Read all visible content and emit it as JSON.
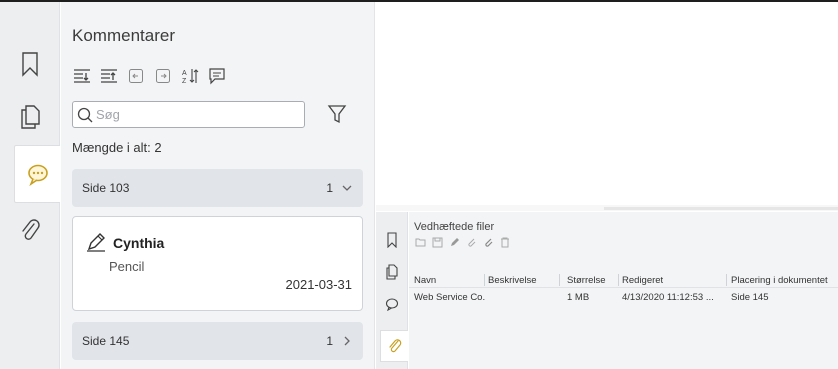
{
  "rail": {
    "tabs": [
      {
        "name": "bookmark-icon",
        "active": false
      },
      {
        "name": "pages-icon",
        "active": false
      },
      {
        "name": "comments-icon",
        "active": true
      },
      {
        "name": "attachment-icon",
        "active": false
      }
    ]
  },
  "comments_panel": {
    "title": "Kommentarer",
    "search_placeholder": "Søg",
    "count_label": "Mængde i alt: 2",
    "groups": [
      {
        "label": "Side 103",
        "count": "1",
        "expanded": true
      },
      {
        "label": "Side 145",
        "count": "1",
        "expanded": false
      }
    ],
    "card": {
      "author": "Cynthia",
      "type": "Pencil",
      "date": "2021-03-31"
    }
  },
  "attachments": {
    "title": "Vedhæftede filer",
    "columns": [
      "Navn",
      "Beskrivelse",
      "Størrelse",
      "Redigeret",
      "Placering i dokumentet"
    ],
    "rows": [
      {
        "name": "Web Service Co...",
        "description": "",
        "size": "1 MB",
        "modified": "4/13/2020 11:12:53 ...",
        "location": "Side 145"
      }
    ]
  },
  "colors": {
    "rail_bg": "#eceef0",
    "panel_bg": "#f3f4f6",
    "group_bg": "#e1e4e9",
    "comment_icon_accent": "#c8a020"
  }
}
